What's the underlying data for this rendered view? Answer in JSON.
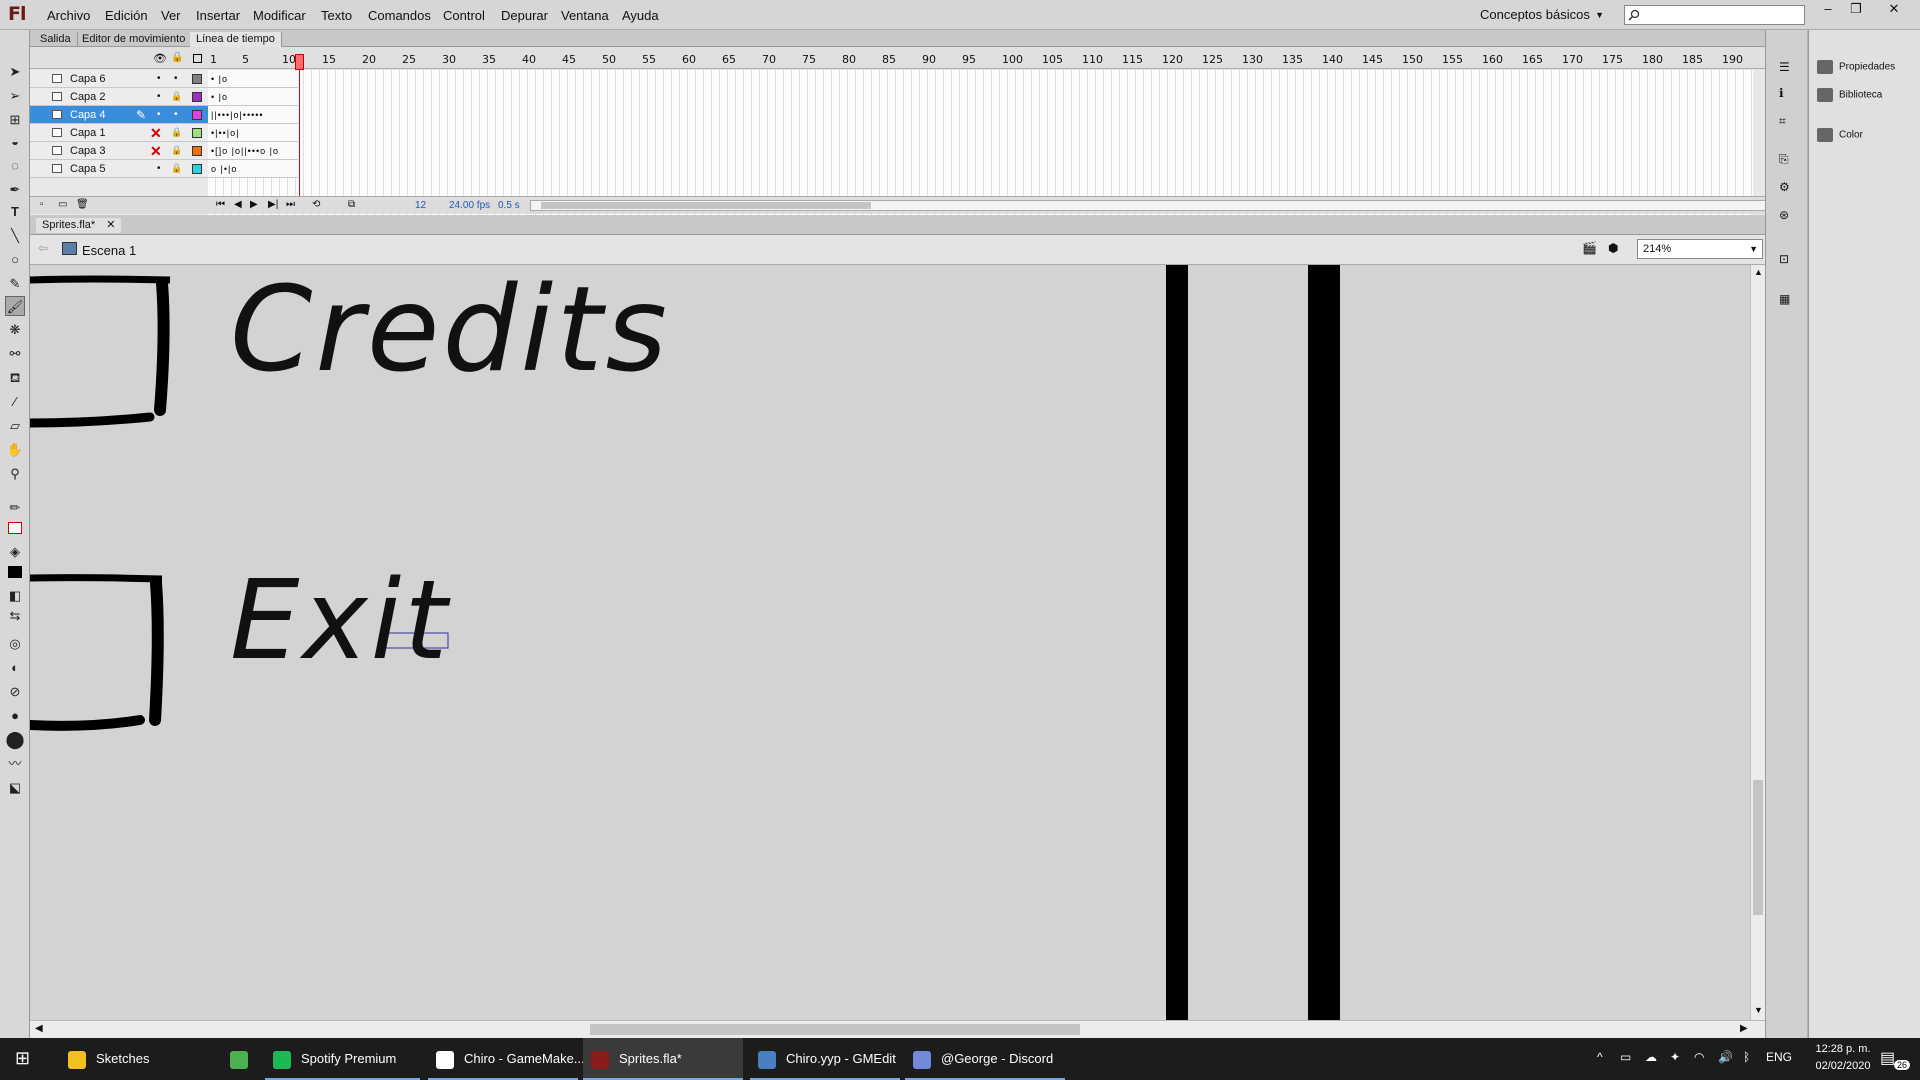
{
  "app": {
    "logo": "Fl",
    "menu": [
      "Archivo",
      "Edición",
      "Ver",
      "Insertar",
      "Modificar",
      "Texto",
      "Comandos",
      "Control",
      "Depurar",
      "Ventana",
      "Ayuda"
    ],
    "workspace": "Conceptos básicos",
    "window_controls": [
      "–",
      "❐",
      "✕"
    ]
  },
  "panel_tabs": [
    "Salida",
    "Editor de movimiento",
    "Línea de tiempo"
  ],
  "timeline": {
    "frame_numbers": [
      "1",
      "5",
      "10",
      "15",
      "20",
      "25",
      "30",
      "35",
      "40",
      "45",
      "50",
      "55",
      "60",
      "65",
      "70",
      "75",
      "80",
      "85",
      "90",
      "95",
      "100",
      "105",
      "110",
      "115",
      "120",
      "125",
      "130",
      "135",
      "140",
      "145",
      "150",
      "155",
      "160",
      "165",
      "170",
      "175",
      "180",
      "185",
      "190"
    ],
    "layers": [
      {
        "name": "Capa 6",
        "selected": false,
        "hidden": false,
        "locked": false,
        "color": "#808080",
        "frames": "•     |o"
      },
      {
        "name": "Capa 2",
        "selected": false,
        "hidden": false,
        "locked": true,
        "color": "#a030c0",
        "frames": "•     |o"
      },
      {
        "name": "Capa 4",
        "selected": true,
        "hidden": false,
        "locked": false,
        "color": "#e040e0",
        "frames": "||•••|o|•••••"
      },
      {
        "name": "Capa 1",
        "selected": false,
        "hidden": true,
        "locked": true,
        "color": "#a0e080",
        "frames": "•|••|o|"
      },
      {
        "name": "Capa 3",
        "selected": false,
        "hidden": true,
        "locked": true,
        "color": "#f07010",
        "frames": "•[]o |o||•••o |o"
      },
      {
        "name": "Capa 5",
        "selected": false,
        "hidden": false,
        "locked": true,
        "color": "#30d0e0",
        "frames": "o  |•|o"
      }
    ],
    "current_frame": "12",
    "fps": "24.00 fps",
    "time": "0.5 s"
  },
  "document": {
    "tab": "Sprites.fla*",
    "scene": "Escena 1",
    "zoom": "214%",
    "stage_text": [
      "Credits",
      "Exit"
    ]
  },
  "right_panel": [
    "Propiedades",
    "Biblioteca",
    "Color"
  ],
  "taskbar": {
    "items": [
      {
        "label": "Sketches",
        "color": "#f2c020",
        "open": false,
        "active": false
      },
      {
        "label": "",
        "color": "#4caf50",
        "open": false,
        "active": false
      },
      {
        "label": "Spotify Premium",
        "color": "#1db954",
        "open": true,
        "active": false
      },
      {
        "label": "Chiro - GameMake...",
        "color": "#ffffff",
        "open": true,
        "active": false
      },
      {
        "label": "Sprites.fla*",
        "color": "#8b1a1a",
        "open": true,
        "active": true
      },
      {
        "label": "Chiro.yyp - GMEdit",
        "color": "#4a80c0",
        "open": true,
        "active": false
      },
      {
        "label": "@George - Discord",
        "color": "#7289da",
        "open": true,
        "active": false
      }
    ],
    "lang": "ENG",
    "time": "12:28 p. m.",
    "date": "02/02/2020",
    "notifications": "26"
  }
}
